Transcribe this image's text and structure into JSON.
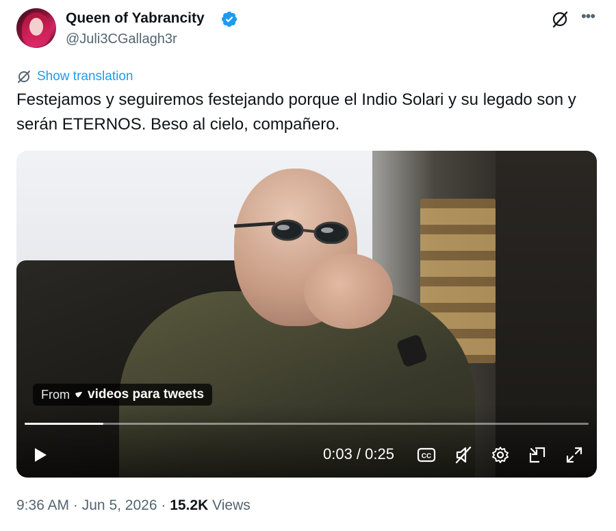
{
  "author": {
    "name": "Queen of Yabrancity",
    "handle": "@Juli3CGallagh3r",
    "verified": true
  },
  "actions": {
    "grok_icon": "grok-icon",
    "more_icon": "more-icon",
    "more_label": "•••"
  },
  "translation": {
    "label": "Show translation",
    "icon": "translate-icon"
  },
  "tweet": {
    "text": "Festejamos y seguiremos festejando porque el Indio Solari y su legado son y serán ETERNOS. Beso al cielo, compañero."
  },
  "video": {
    "credit_from": "From",
    "credit_source": "videos para tweets",
    "progress_fraction": 0.14,
    "time_display": "0:03 / 0:25",
    "controls": {
      "play_icon": "play-icon",
      "cc_icon": "captions-icon",
      "mute_icon": "mute-icon",
      "settings_icon": "gear-icon",
      "pip_icon": "pip-icon",
      "fullscreen_icon": "fullscreen-icon"
    }
  },
  "meta": {
    "time": "9:36 AM",
    "separator": "·",
    "date": "Jun 5, 2026",
    "views_count": "15.2K",
    "views_label": "Views"
  },
  "colors": {
    "accent": "#1d9bf0",
    "text_primary": "#0f1419",
    "text_secondary": "#536471"
  }
}
